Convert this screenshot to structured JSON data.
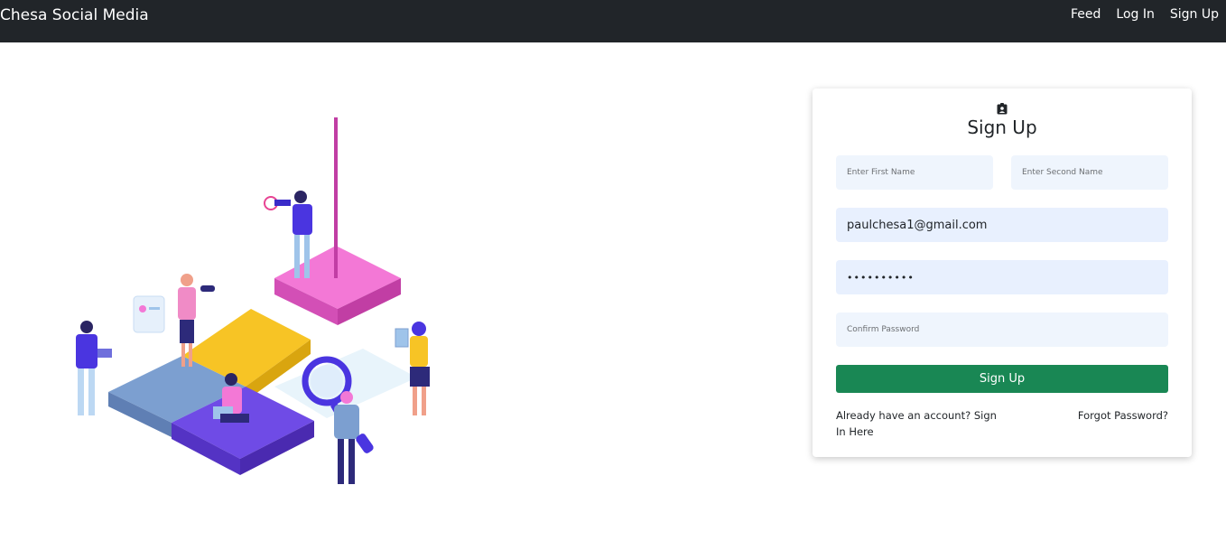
{
  "navbar": {
    "brand": "Chesa Social Media",
    "links": [
      "Feed",
      "Log In",
      "Sign Up"
    ]
  },
  "form": {
    "icon": "contact-card-icon",
    "title": "Sign Up",
    "first_name_placeholder": "Enter First Name",
    "second_name_placeholder": "Enter Second Name",
    "email_value": "paulchesa1@gmail.com",
    "password_value": "••••••••••",
    "confirm_placeholder": "Confirm Password",
    "submit_label": "Sign Up",
    "signin_link": "Already have an account? Sign In Here",
    "forgot_link": "Forgot Password?"
  },
  "colors": {
    "navbar": "#212529",
    "button": "#198754",
    "input_bg": "#eff5fd"
  }
}
